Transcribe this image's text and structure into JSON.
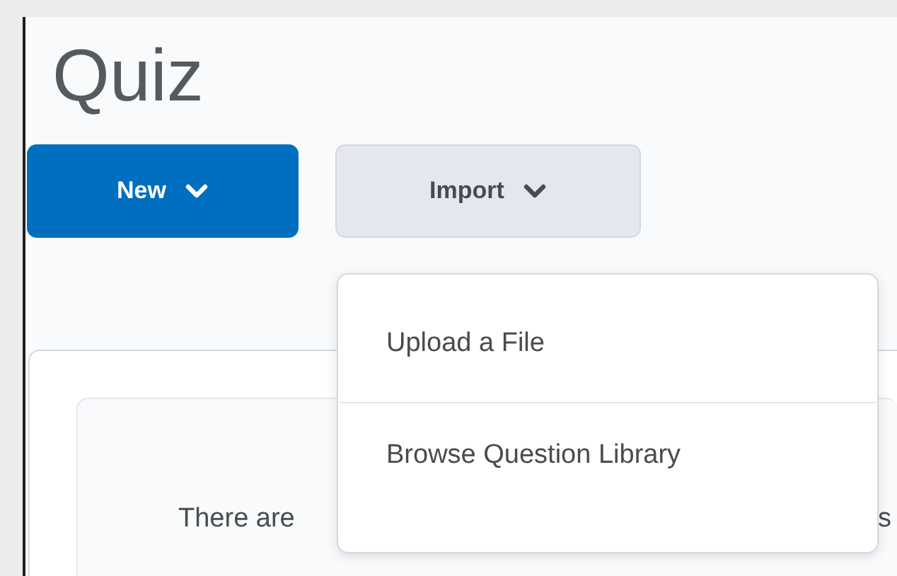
{
  "page": {
    "title": "Quiz"
  },
  "buttons": [
    {
      "label": "New",
      "kind": "primary"
    },
    {
      "label": "Import",
      "kind": "secondary",
      "expanded": true
    }
  ],
  "menu": {
    "items": [
      {
        "label": "Upload a File"
      },
      {
        "label": "Browse Question Library"
      }
    ]
  },
  "empty_state": {
    "text_start": "There are",
    "text_end": "s"
  }
}
